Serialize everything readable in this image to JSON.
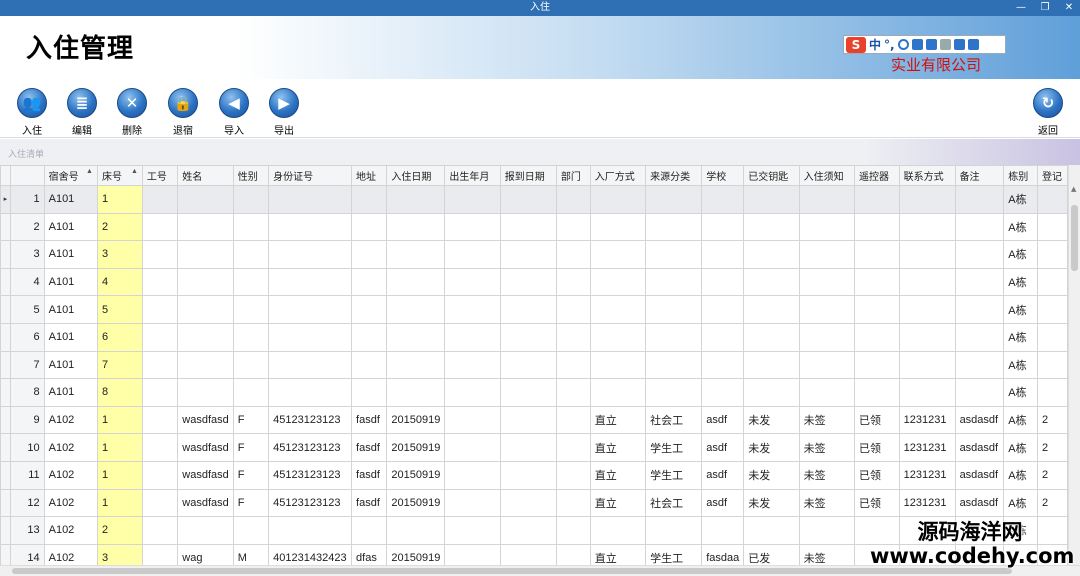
{
  "window": {
    "title": "入住",
    "controls": [
      "—",
      "❐",
      "✕"
    ]
  },
  "banner": {
    "app_title": "入住管理",
    "company": "实业有限公司",
    "ime": {
      "logo": "S",
      "mode": "中",
      "punct": "°,"
    }
  },
  "toolbar": [
    {
      "label": "入住",
      "icon": "users-icon",
      "glyph": "👥"
    },
    {
      "label": "编辑",
      "icon": "document-icon",
      "glyph": "≣"
    },
    {
      "label": "删除",
      "icon": "delete-icon",
      "glyph": "✕"
    },
    {
      "label": "退宿",
      "icon": "lock-icon",
      "glyph": "🔒"
    },
    {
      "label": "导入",
      "icon": "arrow-left-icon",
      "glyph": "◀"
    },
    {
      "label": "导出",
      "icon": "arrow-right-icon",
      "glyph": "▶"
    }
  ],
  "back_button": {
    "label": "返回",
    "icon": "refresh-icon",
    "glyph": "↻"
  },
  "grid": {
    "caption": "入住清单",
    "columns": [
      "宿舍号",
      "床号",
      "工号",
      "姓名",
      "性别",
      "身份证号",
      "地址",
      "入住日期",
      "出生年月",
      "报到日期",
      "部门",
      "入厂方式",
      "来源分类",
      "学校",
      "已交钥匙",
      "入住须知",
      "遥控器",
      "联系方式",
      "备注",
      "栋别",
      "登记"
    ],
    "selected_row_marker": "▸",
    "rows": [
      {
        "n": "1",
        "cells": [
          "A101",
          "1",
          "",
          "",
          "",
          "",
          "",
          "",
          "",
          "",
          "",
          "",
          "",
          "",
          "",
          "",
          "",
          "",
          "",
          "A栋",
          ""
        ]
      },
      {
        "n": "2",
        "cells": [
          "A101",
          "2",
          "",
          "",
          "",
          "",
          "",
          "",
          "",
          "",
          "",
          "",
          "",
          "",
          "",
          "",
          "",
          "",
          "",
          "A栋",
          ""
        ]
      },
      {
        "n": "3",
        "cells": [
          "A101",
          "3",
          "",
          "",
          "",
          "",
          "",
          "",
          "",
          "",
          "",
          "",
          "",
          "",
          "",
          "",
          "",
          "",
          "",
          "A栋",
          ""
        ]
      },
      {
        "n": "4",
        "cells": [
          "A101",
          "4",
          "",
          "",
          "",
          "",
          "",
          "",
          "",
          "",
          "",
          "",
          "",
          "",
          "",
          "",
          "",
          "",
          "",
          "A栋",
          ""
        ]
      },
      {
        "n": "5",
        "cells": [
          "A101",
          "5",
          "",
          "",
          "",
          "",
          "",
          "",
          "",
          "",
          "",
          "",
          "",
          "",
          "",
          "",
          "",
          "",
          "",
          "A栋",
          ""
        ]
      },
      {
        "n": "6",
        "cells": [
          "A101",
          "6",
          "",
          "",
          "",
          "",
          "",
          "",
          "",
          "",
          "",
          "",
          "",
          "",
          "",
          "",
          "",
          "",
          "",
          "A栋",
          ""
        ]
      },
      {
        "n": "7",
        "cells": [
          "A101",
          "7",
          "",
          "",
          "",
          "",
          "",
          "",
          "",
          "",
          "",
          "",
          "",
          "",
          "",
          "",
          "",
          "",
          "",
          "A栋",
          ""
        ]
      },
      {
        "n": "8",
        "cells": [
          "A101",
          "8",
          "",
          "",
          "",
          "",
          "",
          "",
          "",
          "",
          "",
          "",
          "",
          "",
          "",
          "",
          "",
          "",
          "",
          "A栋",
          ""
        ]
      },
      {
        "n": "9",
        "cells": [
          "A102",
          "1",
          "",
          "wasdfasd",
          "F",
          "45123123123",
          "fasdf",
          "20150919",
          "",
          "",
          "",
          "直立",
          "社会工",
          "asdf",
          "未发",
          "未签",
          "已领",
          "1231231",
          "asdasdf",
          "A栋",
          "2"
        ]
      },
      {
        "n": "10",
        "cells": [
          "A102",
          "1",
          "",
          "wasdfasd",
          "F",
          "45123123123",
          "fasdf",
          "20150919",
          "",
          "",
          "",
          "直立",
          "学生工",
          "asdf",
          "未发",
          "未签",
          "已领",
          "1231231",
          "asdasdf",
          "A栋",
          "2"
        ]
      },
      {
        "n": "11",
        "cells": [
          "A102",
          "1",
          "",
          "wasdfasd",
          "F",
          "45123123123",
          "fasdf",
          "20150919",
          "",
          "",
          "",
          "直立",
          "学生工",
          "asdf",
          "未发",
          "未签",
          "已领",
          "1231231",
          "asdasdf",
          "A栋",
          "2"
        ]
      },
      {
        "n": "12",
        "cells": [
          "A102",
          "1",
          "",
          "wasdfasd",
          "F",
          "45123123123",
          "fasdf",
          "20150919",
          "",
          "",
          "",
          "直立",
          "社会工",
          "asdf",
          "未发",
          "未签",
          "已领",
          "1231231",
          "asdasdf",
          "A栋",
          "2"
        ]
      },
      {
        "n": "13",
        "cells": [
          "A102",
          "2",
          "",
          "",
          "",
          "",
          "",
          "",
          "",
          "",
          "",
          "",
          "",
          "",
          "",
          "",
          "",
          "",
          "",
          "A栋",
          ""
        ]
      },
      {
        "n": "14",
        "cells": [
          "A102",
          "3",
          "",
          "wag",
          "M",
          "401231432423",
          "dfas",
          "20150919",
          "",
          "",
          "",
          "直立",
          "学生工",
          "fasdaa",
          "已发",
          "未签",
          "",
          "",
          "",
          "",
          ""
        ]
      }
    ]
  },
  "watermark": {
    "line1": "源码海洋网",
    "line2": "www.codehy.com"
  }
}
